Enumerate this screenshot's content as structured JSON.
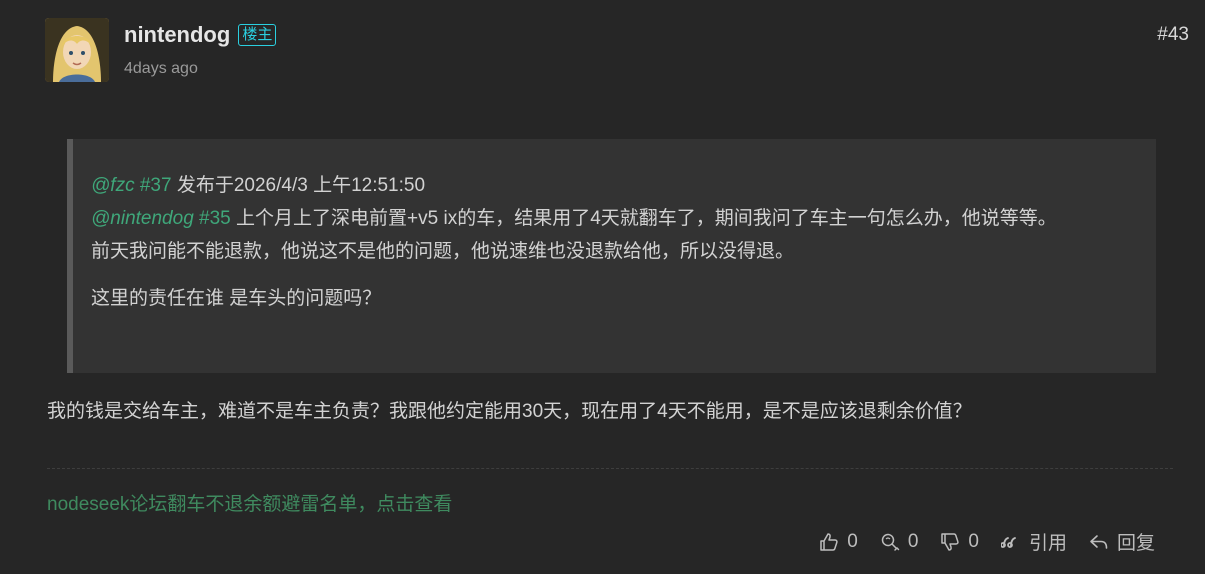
{
  "post": {
    "author": "nintendog",
    "op_badge": "楼主",
    "time": "4days ago",
    "number": "#43"
  },
  "quote": {
    "line1": {
      "mention": "@fzc",
      "ref": "#37",
      "text": "发布于2026/4/3 上午12:51:50"
    },
    "line2": {
      "mention": "@nintendog",
      "ref": "#35",
      "text": "上个月上了深电前置+v5 ix的车，结果用了4天就翻车了，期间我问了车主一句怎么办，他说等等。"
    },
    "line3": "前天我问能不能退款，他说这不是他的问题，他说速维也没退款给他，所以没得退。",
    "line4": "这里的责任在谁 是车头的问题吗？"
  },
  "reply": "我的钱是交给车主，难道不是车主负责？我跟他约定能用30天，现在用了4天不能用，是不是应该退剩余价值？",
  "signature": "nodeseek论坛翻车不退余额避雷名单，点击查看",
  "actions": {
    "like_count": "0",
    "chicken_count": "0",
    "dislike_count": "0",
    "quote_label": "引用",
    "reply_label": "回复"
  },
  "icons": [
    "thumbs-up-icon",
    "chicken-leg-icon",
    "thumbs-down-icon",
    "quote-icon",
    "reply-icon"
  ]
}
